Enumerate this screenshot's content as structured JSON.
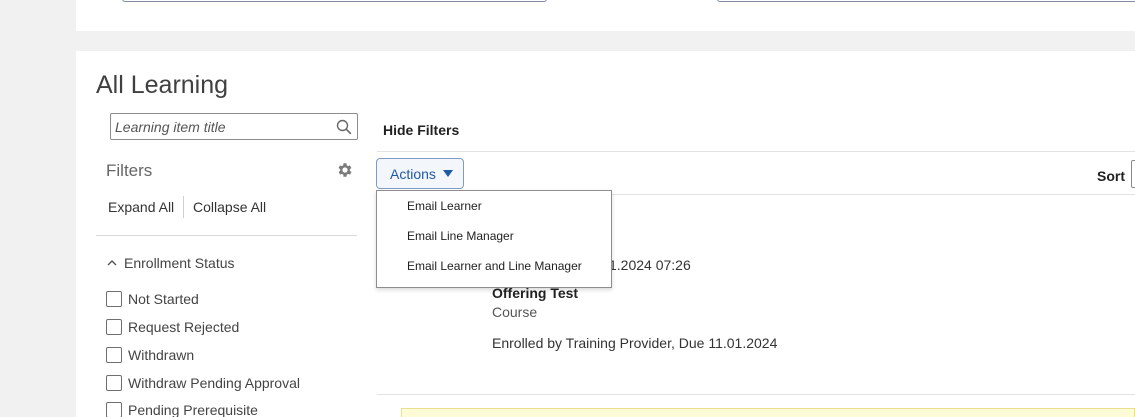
{
  "page": {
    "title": "All Learning"
  },
  "search": {
    "placeholder": "Learning item title",
    "value": ""
  },
  "toolbar": {
    "hide_filters_label": "Hide Filters",
    "actions_label": "Actions",
    "sort_label": "Sort"
  },
  "filters": {
    "title": "Filters",
    "expand_all_label": "Expand All",
    "collapse_all_label": "Collapse All",
    "sections": [
      {
        "title": "Enrollment Status",
        "options": [
          {
            "label": "Not Started",
            "checked": false
          },
          {
            "label": "Request Rejected",
            "checked": false
          },
          {
            "label": "Withdrawn",
            "checked": false
          },
          {
            "label": "Withdraw Pending Approval",
            "checked": false
          },
          {
            "label": "Pending Prerequisite",
            "checked": false
          }
        ]
      }
    ]
  },
  "actions_menu": {
    "items": [
      {
        "label": "Email Learner"
      },
      {
        "label": "Email Line Manager"
      },
      {
        "label": "Email Learner and Line Manager"
      }
    ]
  },
  "learning_item": {
    "date_fragment": "1.2024 07:26",
    "title": "Offering Test",
    "type": "Course",
    "status": "Enrolled by Training Provider, Due 11.01.2024"
  },
  "colors": {
    "accent": "#1f5aa6",
    "page_background": "#f1f1f1",
    "banner_background": "#fefbd7"
  }
}
